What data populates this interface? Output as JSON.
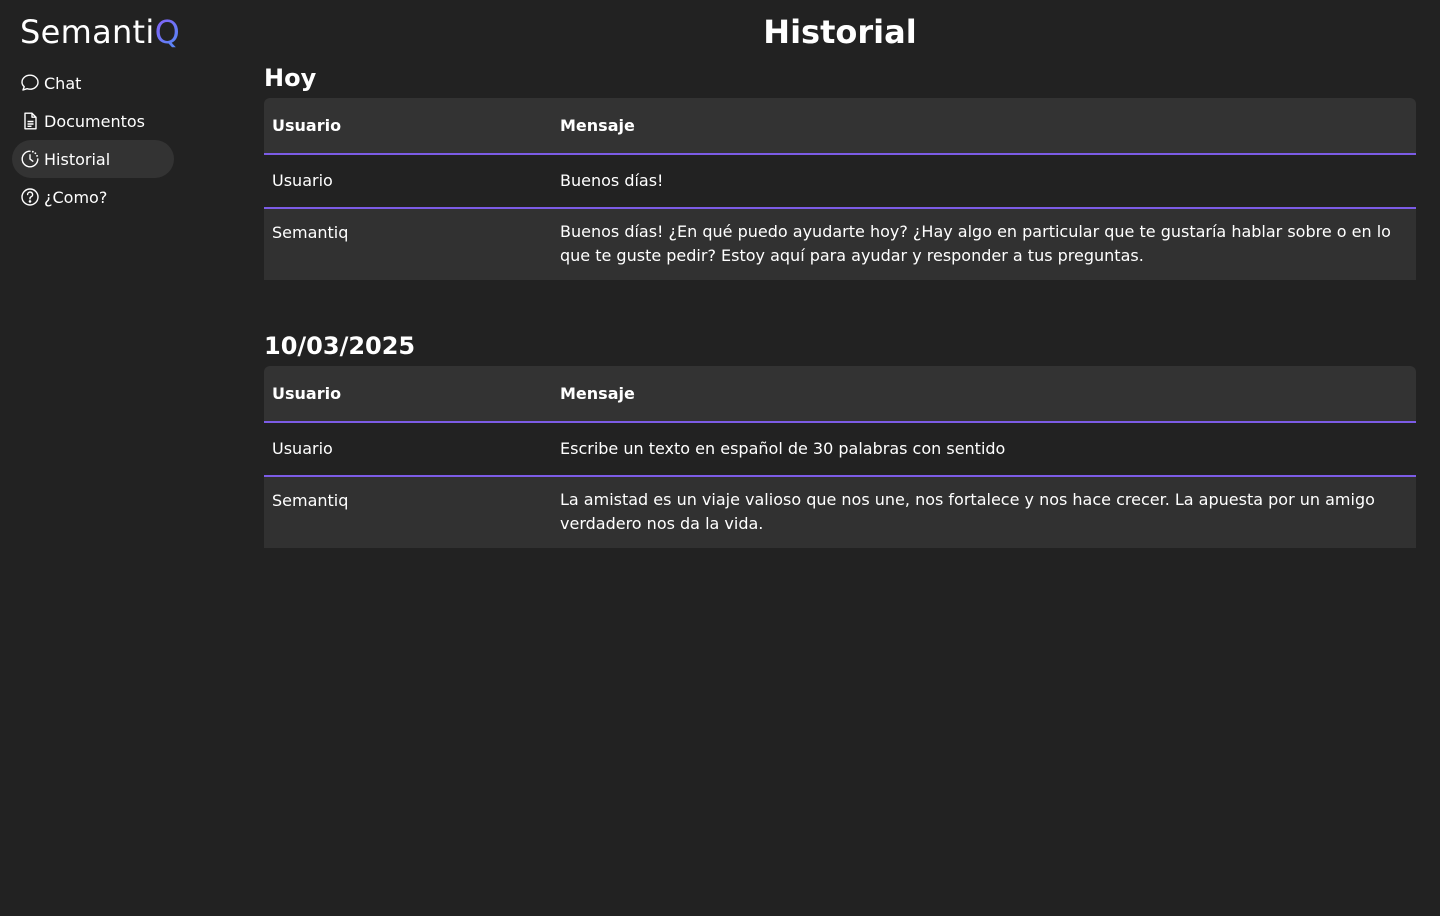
{
  "app": {
    "logo_prefix": "Semanti",
    "logo_suffix": "Q"
  },
  "sidebar": {
    "items": [
      {
        "label": "Chat",
        "icon": "chat-bubble-icon",
        "active": false
      },
      {
        "label": "Documentos",
        "icon": "document-icon",
        "active": false
      },
      {
        "label": "Historial",
        "icon": "history-clock-icon",
        "active": true
      },
      {
        "label": "¿Como?",
        "icon": "help-circle-icon",
        "active": false
      }
    ]
  },
  "main": {
    "title": "Historial",
    "sections": [
      {
        "title": "Hoy",
        "headers": {
          "user": "Usuario",
          "message": "Mensaje"
        },
        "rows": [
          {
            "user": "Usuario",
            "message": "Buenos días!"
          },
          {
            "user": "Semantiq",
            "message": "Buenos días! ¿En qué puedo ayudarte hoy? ¿Hay algo en particular que te gustaría hablar sobre o en lo que te guste pedir? Estoy aquí para ayudar y responder a tus preguntas."
          }
        ]
      },
      {
        "title": "10/03/2025",
        "headers": {
          "user": "Usuario",
          "message": "Mensaje"
        },
        "rows": [
          {
            "user": "Usuario",
            "message": "Escribe un texto en español de 30 palabras con sentido"
          },
          {
            "user": "Semantiq",
            "message": "La amistad es un viaje valioso que nos une, nos fortalece y nos hace crecer. La apuesta por un amigo verdadero nos da la vida."
          }
        ]
      }
    ]
  },
  "colors": {
    "background": "#222222",
    "surface": "#333333",
    "accent": "#7c5ce6",
    "logo_gradient_start": "#8b5cf6",
    "logo_gradient_end": "#4f8df5"
  }
}
